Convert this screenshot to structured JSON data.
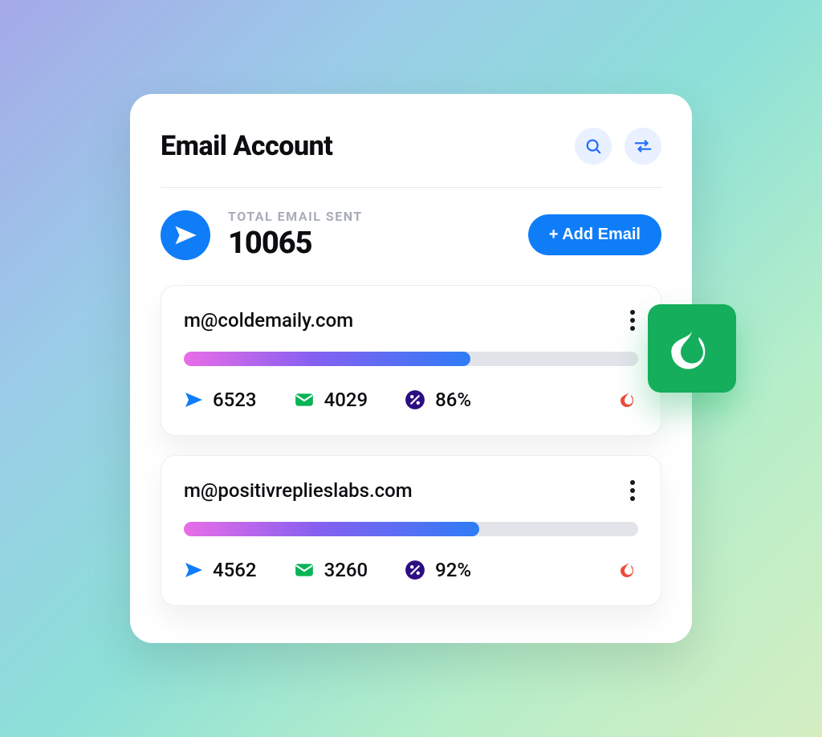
{
  "header": {
    "title": "Email Account"
  },
  "total": {
    "label": "TOTAL EMAIL SENT",
    "value": "10065"
  },
  "actions": {
    "add_email": "+ Add Email"
  },
  "accounts": [
    {
      "email": "m@coldemaily.com",
      "progress_percent": 63,
      "sent": "6523",
      "opens": "4029",
      "rate": "86%"
    },
    {
      "email": "m@positivreplieslabs.com",
      "progress_percent": 65,
      "sent": "4562",
      "opens": "3260",
      "rate": "92%"
    }
  ],
  "colors": {
    "primary": "#0f7df8",
    "badge": "#14ae5c"
  }
}
